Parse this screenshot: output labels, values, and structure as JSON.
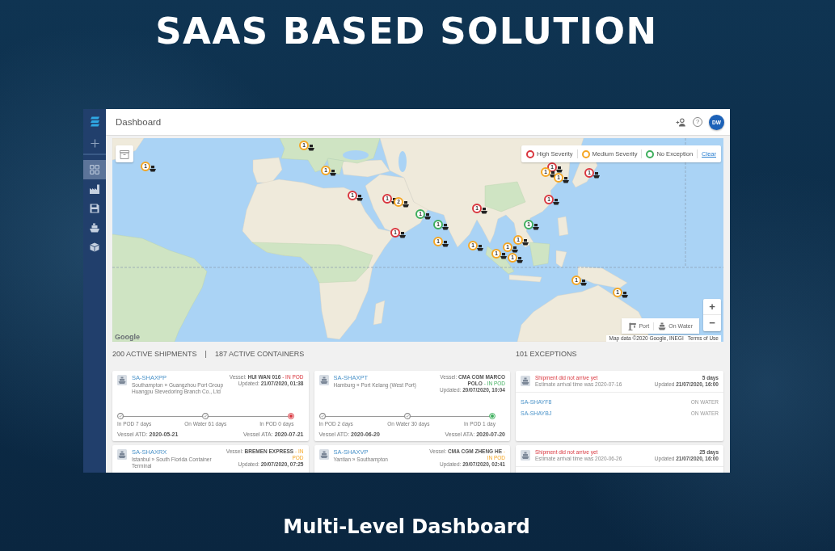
{
  "title": "SAAS BASED SOLUTION",
  "app": {
    "sidebar": {
      "nav": [
        {
          "selected": true
        },
        {
          "selected": false
        },
        {
          "selected": false
        },
        {
          "selected": false
        },
        {
          "selected": false
        }
      ]
    },
    "header": {
      "title": "Dashboard",
      "help": "?",
      "avatar": "DW"
    },
    "map": {
      "markers": [
        {
          "count": "1",
          "color": "#f5a623"
        },
        {
          "count": "1",
          "color": "#f5a623"
        },
        {
          "count": "1",
          "color": "#f5a623"
        },
        {
          "count": "1",
          "color": "#d9363e"
        },
        {
          "count": "1",
          "color": "#d9363e"
        },
        {
          "count": "2",
          "color": "#f5a623"
        },
        {
          "count": "1",
          "color": "#3dae5c"
        },
        {
          "count": "1",
          "color": "#3dae5c"
        },
        {
          "count": "1",
          "color": "#d9363e"
        },
        {
          "count": "1",
          "color": "#d9363e"
        },
        {
          "count": "1",
          "color": "#3dae5c"
        },
        {
          "count": "1",
          "color": "#d9363e"
        },
        {
          "count": "1",
          "color": "#f5a623"
        },
        {
          "count": "1",
          "color": "#f5a623"
        },
        {
          "count": "1",
          "color": "#d9363e"
        },
        {
          "count": "1",
          "color": "#d9363e"
        },
        {
          "count": "1",
          "color": "#f5a623"
        },
        {
          "count": "1",
          "color": "#f5a623"
        },
        {
          "count": "1",
          "color": "#f5a623"
        },
        {
          "count": "1",
          "color": "#f5a623"
        },
        {
          "count": "1",
          "color": "#f5a623"
        },
        {
          "count": "1",
          "color": "#f5a623"
        },
        {
          "count": "1",
          "color": "#f5a623"
        },
        {
          "count": "1",
          "color": "#f5a623"
        }
      ],
      "legend": [
        {
          "label": "High Severity",
          "color": "#d9363e"
        },
        {
          "label": "Medium Severity",
          "color": "#f5a623"
        },
        {
          "label": "No Exception",
          "color": "#3dae5c"
        }
      ],
      "clear": "Clear",
      "zoom": [
        "+",
        "−"
      ],
      "filters": [
        {
          "label": "Port"
        },
        {
          "label": "On Water"
        }
      ],
      "logo": "Google",
      "attribution": "Map data ©2020 Google, INEGI",
      "terms": "Terms of Use"
    },
    "stats": {
      "shipments": "200 ACTIVE SHIPMENTS",
      "separator": "|",
      "containers": "187 ACTIVE CONTAINERS",
      "exceptions": "101 EXCEPTIONS"
    },
    "shipments": [
      {
        "kind": "high",
        "id": "SA-SHAXPP",
        "route": "Southampton » Guangzhou Port Group Huangpu Stevedoring Branch Co., Ltd",
        "vessel_label": "Vessel:",
        "vessel": "HUI WAN 016",
        "status": "- IN POD",
        "updated_label": "Updated:",
        "updated": "21/07/2020, 01:38",
        "timeline": [
          {
            "label": "In POD 7 days",
            "current": false
          },
          {
            "label": "On Water 61 days",
            "current": false
          },
          {
            "label": "In POD 0 days",
            "current": true
          }
        ],
        "atd_label": "Vessel ATD:",
        "atd": "2020-05-21",
        "ata_label": "Vessel ATA:",
        "ata": "2020-07-21"
      },
      {
        "kind": "clear",
        "id": "SA-SHAXPT",
        "route": "Hamburg » Port Kelang (West Port)",
        "vessel_label": "Vessel:",
        "vessel": "CMA CGM MARCO POLO",
        "status": "- IN POD",
        "updated_label": "Updated:",
        "updated": "20/07/2020, 10:04",
        "timeline": [
          {
            "label": "In POD 2 days",
            "current": false
          },
          {
            "label": "On Water 30 days",
            "current": false
          },
          {
            "label": "In POD 1 day",
            "current": true
          }
        ],
        "atd_label": "Vessel ATD:",
        "atd": "2020-06-20",
        "ata_label": "Vessel ATA:",
        "ata": "2020-07-20"
      },
      {
        "kind": "medium",
        "id": "SA-SHAXRX",
        "route": "Istanbul » South Florida Container Terminal",
        "vessel_label": "Vessel:",
        "vessel": "BREMEN EXPRESS",
        "status": "- IN POD",
        "updated_label": "Updated:",
        "updated": "20/07/2020, 07:25"
      },
      {
        "kind": "medium",
        "id": "SA-SHAXVP",
        "route": "Yantian » Southampton",
        "vessel_label": "Vessel:",
        "vessel": "CMA CGM ZHENG HE",
        "status": "- IN POD",
        "updated_label": "Updated:",
        "updated": "20/07/2020, 02:41"
      }
    ],
    "exceptions": [
      {
        "title": "Shipment did not arrive yet",
        "detail": "Estimate arrival time was 2020-07-16",
        "duration": "5 days",
        "updated_label": "Updated",
        "updated": "21/07/2020, 16:00",
        "shipments": [
          {
            "id": "SA-SHAYF8",
            "status": "ON WATER"
          },
          {
            "id": "SA-SHAYBJ",
            "status": "ON WATER"
          }
        ]
      },
      {
        "title": "Shipment did not arrive yet",
        "detail": "Estimate arrival time was 2020-06-26",
        "duration": "25 days",
        "updated_label": "Updated",
        "updated": "21/07/2020, 16:00"
      }
    ]
  },
  "caption": "Multi-Level Dashboard"
}
